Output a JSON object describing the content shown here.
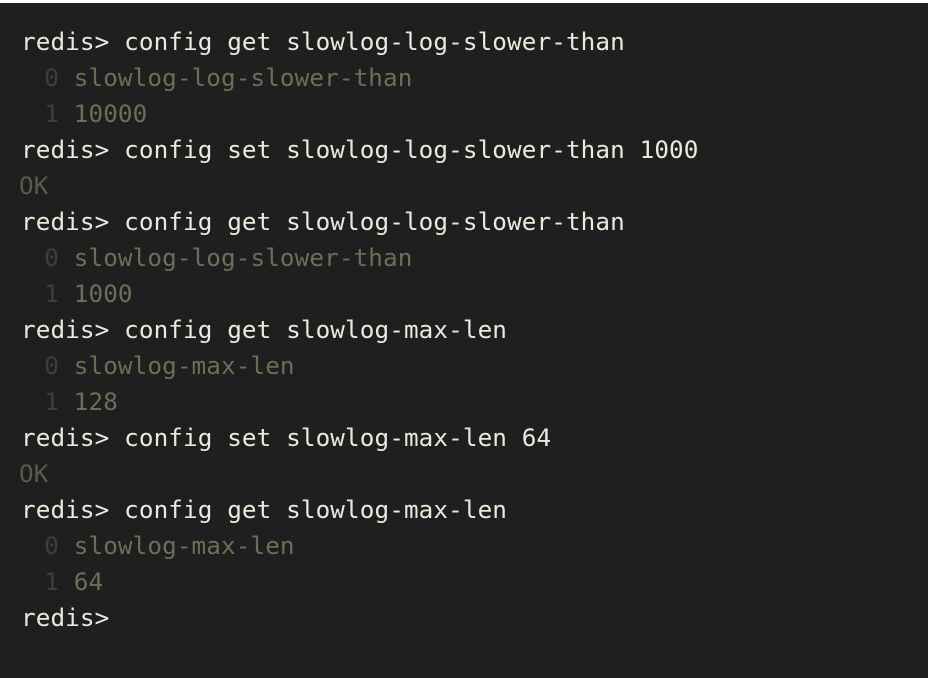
{
  "terminal": {
    "lines": [
      {
        "type": "cmd",
        "prompt": "redis>",
        "text": "config get slowlog-log-slower-than"
      },
      {
        "type": "item",
        "index": "0",
        "value": "slowlog-log-slower-than"
      },
      {
        "type": "item",
        "index": "1",
        "value": "10000"
      },
      {
        "type": "cmd",
        "prompt": "redis>",
        "text": "config set slowlog-log-slower-than 1000"
      },
      {
        "type": "ok",
        "value": "OK"
      },
      {
        "type": "cmd",
        "prompt": "redis>",
        "text": "config get slowlog-log-slower-than"
      },
      {
        "type": "item",
        "index": "0",
        "value": "slowlog-log-slower-than"
      },
      {
        "type": "item",
        "index": "1",
        "value": "1000"
      },
      {
        "type": "cmd",
        "prompt": "redis>",
        "text": "config get slowlog-max-len"
      },
      {
        "type": "item",
        "index": "0",
        "value": "slowlog-max-len"
      },
      {
        "type": "item",
        "index": "1",
        "value": "128"
      },
      {
        "type": "cmd",
        "prompt": "redis>",
        "text": "config set slowlog-max-len 64"
      },
      {
        "type": "ok",
        "value": "OK"
      },
      {
        "type": "cmd",
        "prompt": "redis>",
        "text": "config get slowlog-max-len"
      },
      {
        "type": "item",
        "index": "0",
        "value": "slowlog-max-len"
      },
      {
        "type": "item",
        "index": "1",
        "value": "64"
      },
      {
        "type": "prompt",
        "prompt": "redis>"
      }
    ]
  },
  "colors": {
    "background": "#1f1f1f",
    "command_text": "#ece8dc",
    "output_text": "#6d6e58",
    "index_text": "#3e3f36"
  }
}
